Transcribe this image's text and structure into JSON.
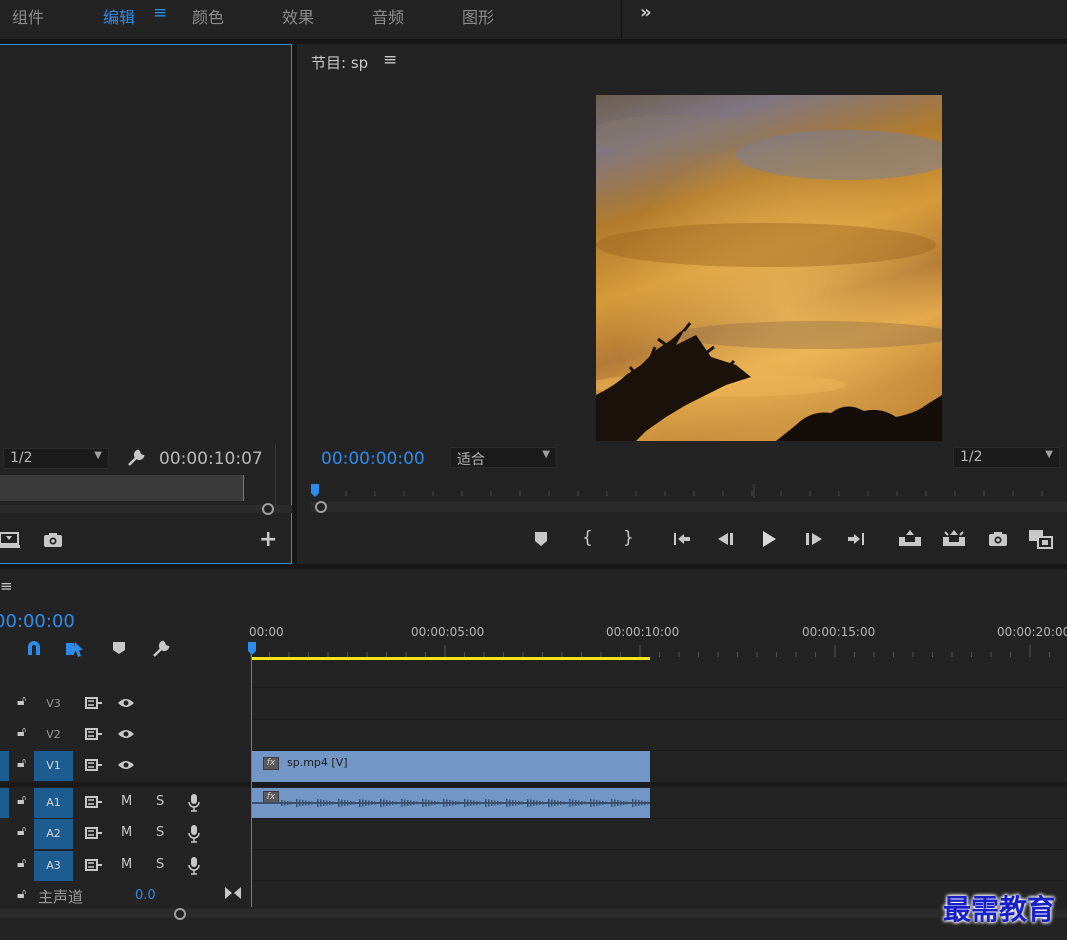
{
  "workspace": {
    "tabs": [
      {
        "label": "组件"
      },
      {
        "label": "编辑"
      },
      {
        "label": "颜色"
      },
      {
        "label": "效果"
      },
      {
        "label": "音频"
      },
      {
        "label": "图形"
      }
    ],
    "active_tab": "编辑",
    "more_glyph": "»"
  },
  "source_monitor": {
    "resolution": "1/2",
    "timecode": "00:00:10:07"
  },
  "program_monitor": {
    "title": "节目: sp",
    "timecode": "00:00:00:00",
    "fit_label": "适合",
    "resolution": "1/2"
  },
  "timeline": {
    "timecode": "00:00:00",
    "ruler_labels": [
      "00:00",
      "00:00:05:00",
      "00:00:10:00",
      "00:00:15:00",
      "00:00:20:00"
    ],
    "tracks": [
      {
        "id": "V3",
        "kind": "video",
        "targeted": false
      },
      {
        "id": "V2",
        "kind": "video",
        "targeted": false
      },
      {
        "id": "V1",
        "kind": "video",
        "targeted": true
      },
      {
        "id": "A1",
        "kind": "audio",
        "targeted": true
      },
      {
        "id": "A2",
        "kind": "audio",
        "targeted": true
      },
      {
        "id": "A3",
        "kind": "audio",
        "targeted": true
      }
    ],
    "mute_label": "M",
    "solo_label": "S",
    "master": {
      "label": "主声道",
      "value": "0.0"
    },
    "clips": {
      "video": {
        "name": "sp.mp4 [V]",
        "fx": "fx"
      },
      "audio": {
        "fx": "fx"
      }
    }
  },
  "watermark": "最需教育",
  "colors": {
    "accent": "#2d8ceb",
    "clip": "#7297c6",
    "work_area": "#f2e61a",
    "track_target": "#1d5c91"
  }
}
